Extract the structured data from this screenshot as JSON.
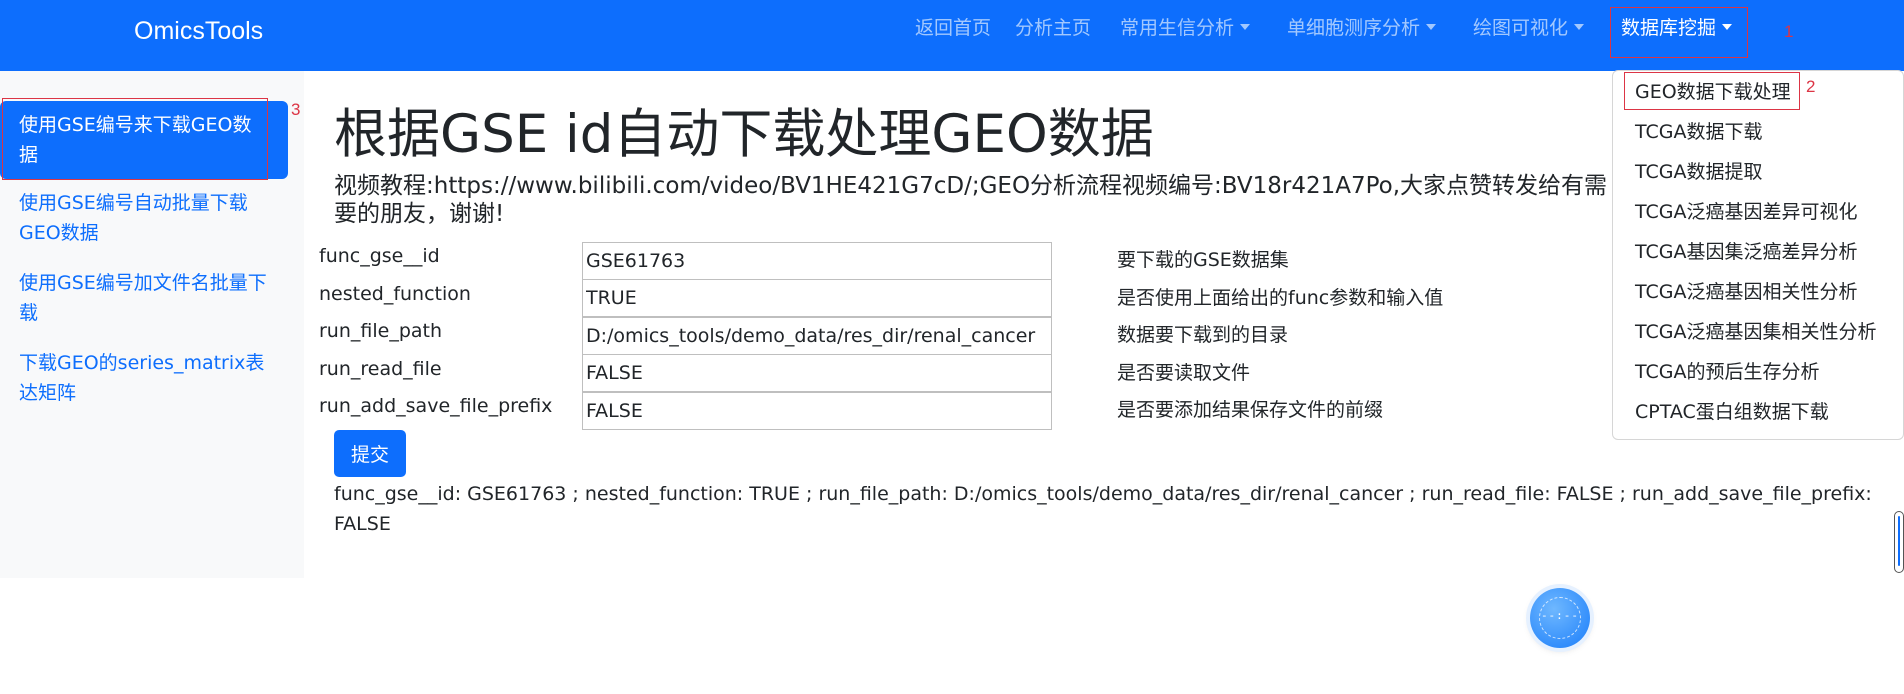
{
  "navbar": {
    "brand": "OmicsTools",
    "links": [
      {
        "label": "返回首页"
      },
      {
        "label": "分析主页"
      },
      {
        "label": "常用生信分析"
      },
      {
        "label": "单细胞测序分析"
      },
      {
        "label": "绘图可视化"
      },
      {
        "label": "数据库挖掘"
      }
    ]
  },
  "annotations": {
    "n1": "1",
    "n2": "2",
    "n3": "3"
  },
  "dropdown": {
    "items": [
      {
        "label": "GEO数据下载处理"
      },
      {
        "label": "TCGA数据下载"
      },
      {
        "label": "TCGA数据提取"
      },
      {
        "label": "TCGA泛癌基因差异可视化"
      },
      {
        "label": "TCGA基因集泛癌差异分析"
      },
      {
        "label": "TCGA泛癌基因相关性分析"
      },
      {
        "label": "TCGA泛癌基因集相关性分析"
      },
      {
        "label": "TCGA的预后生存分析"
      },
      {
        "label": "CPTAC蛋白组数据下载"
      }
    ]
  },
  "sidebar": {
    "items": [
      {
        "label": "使用GSE编号来下载GEO数据"
      },
      {
        "label": "使用GSE编号自动批量下载GEO数据"
      },
      {
        "label": "使用GSE编号加文件名批量下载"
      },
      {
        "label": "下载GEO的series_matrix表达矩阵"
      }
    ]
  },
  "main": {
    "title": "根据GSE id自动下载处理GEO数据",
    "video": "视频教程:https://www.bilibili.com/video/BV1HE421G7cD/;GEO分析流程视频编号:BV18r421A7Po,大家点赞转发给有需要的朋友，谢谢!",
    "params": [
      {
        "label": "func_gse__id",
        "value": "GSE61763",
        "desc": "要下载的GSE数据集"
      },
      {
        "label": "nested_function",
        "value": "TRUE",
        "desc": "是否使用上面给出的func参数和输入值"
      },
      {
        "label": "run_file_path",
        "value": "D:/omics_tools/demo_data/res_dir/renal_cancer",
        "desc": "数据要下载到的目录"
      },
      {
        "label": "run_read_file",
        "value": "FALSE",
        "desc": "是否要读取文件"
      },
      {
        "label": "run_add_save_file_prefix",
        "value": "FALSE",
        "desc": "是否要添加结果保存文件的前缀"
      }
    ],
    "submit_label": "提交",
    "result": "func_gse__id: GSE61763 ; nested_function: TRUE ; run_file_path: D:/omics_tools/demo_data/res_dir/renal_cancer ; run_read_file: FALSE ; run_add_save_file_prefix: FALSE"
  },
  "float_button": {
    "icon": "loading-spinner-icon",
    "text": "--:--"
  },
  "colors": {
    "primary": "#0d6efd",
    "annotation_red": "#dc3545",
    "sidebar_bg": "#f8f9fa"
  }
}
